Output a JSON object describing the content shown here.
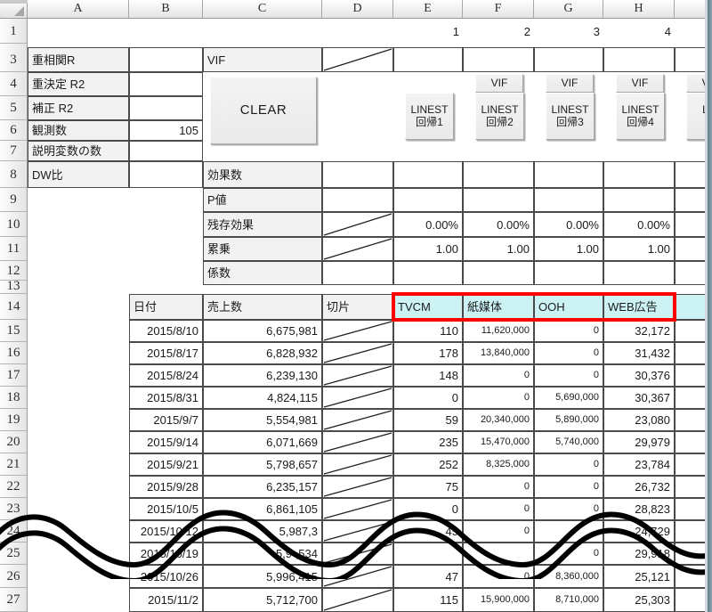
{
  "app": {
    "name": "spreadsheet",
    "kind": "excel-worksheet"
  },
  "grid": {
    "column_letters": [
      "A",
      "B",
      "C",
      "D",
      "E",
      "F",
      "G",
      "H"
    ],
    "row_numbers": [
      "1",
      "3",
      "4",
      "5",
      "6",
      "7",
      "8",
      "9",
      "10",
      "11",
      "12",
      "13",
      "14",
      "15",
      "16",
      "17",
      "18",
      "19",
      "20",
      "21",
      "22",
      "23",
      "24",
      "25",
      "26",
      "27"
    ]
  },
  "model_panel": {
    "labels": {
      "multiple_r": "重相関R",
      "r_square": "重決定 R2",
      "adj_r_square": "補正 R2",
      "observations": "観測数",
      "num_predictors": "説明変数の数",
      "dw_ratio": "DW比"
    },
    "values": {
      "multiple_r": "",
      "r_square": "",
      "adj_r_square": "",
      "observations": "105",
      "num_predictors": "",
      "dw_ratio": ""
    }
  },
  "stats_panel": {
    "row_labels": {
      "vif": "VIF",
      "effect_count": "効果数",
      "p_value": "P値",
      "carryover": "残存効果",
      "power": "累乗",
      "coefficient": "係数"
    },
    "series_index": [
      "1",
      "2",
      "3",
      "4"
    ],
    "carryover_values": [
      "0.00%",
      "0.00%",
      "0.00%",
      "0.00%"
    ],
    "power_values": [
      "1.00",
      "1.00",
      "1.00",
      "1.00"
    ],
    "effect_count_values": [
      "",
      "",
      "",
      ""
    ],
    "p_values": [
      "",
      "",
      "",
      ""
    ],
    "coefficient_values": [
      "",
      "",
      "",
      ""
    ],
    "vif_values": [
      "",
      "",
      "",
      ""
    ]
  },
  "buttons": {
    "clear": "CLEAR",
    "vif": "VIF",
    "linest": [
      {
        "line1": "LINEST",
        "line2": "回帰1"
      },
      {
        "line1": "LINEST",
        "line2": "回帰2"
      },
      {
        "line1": "LINEST",
        "line2": "回帰3"
      },
      {
        "line1": "LINEST",
        "line2": "回帰4"
      },
      {
        "line1": "LIN",
        "line2": "回"
      }
    ]
  },
  "data_table": {
    "headers": [
      "日付",
      "売上数",
      "切片",
      "TVCM",
      "紙媒体",
      "OOH",
      "WEB広告",
      ""
    ],
    "highlight_color": "#ff0000",
    "header_fill": "#ccf2f4",
    "rows": [
      {
        "row": "15",
        "date": "2015/8/10",
        "sales": "6,675,981",
        "intercept": "",
        "tvcm": "110",
        "paper": "11,620,000",
        "ooh": "0",
        "web": "32,172"
      },
      {
        "row": "16",
        "date": "2015/8/17",
        "sales": "6,828,932",
        "intercept": "",
        "tvcm": "178",
        "paper": "13,840,000",
        "ooh": "0",
        "web": "31,432"
      },
      {
        "row": "17",
        "date": "2015/8/24",
        "sales": "6,239,130",
        "intercept": "",
        "tvcm": "148",
        "paper": "0",
        "ooh": "0",
        "web": "30,376"
      },
      {
        "row": "18",
        "date": "2015/8/31",
        "sales": "4,824,115",
        "intercept": "",
        "tvcm": "0",
        "paper": "0",
        "ooh": "5,690,000",
        "web": "30,367"
      },
      {
        "row": "19",
        "date": "2015/9/7",
        "sales": "5,554,981",
        "intercept": "",
        "tvcm": "59",
        "paper": "20,340,000",
        "ooh": "5,890,000",
        "web": "23,080"
      },
      {
        "row": "20",
        "date": "2015/9/14",
        "sales": "6,071,669",
        "intercept": "",
        "tvcm": "235",
        "paper": "15,470,000",
        "ooh": "5,740,000",
        "web": "29,979"
      },
      {
        "row": "21",
        "date": "2015/9/21",
        "sales": "5,798,657",
        "intercept": "",
        "tvcm": "252",
        "paper": "8,325,000",
        "ooh": "0",
        "web": "23,784"
      },
      {
        "row": "22",
        "date": "2015/9/28",
        "sales": "6,235,157",
        "intercept": "",
        "tvcm": "75",
        "paper": "0",
        "ooh": "0",
        "web": "26,732"
      },
      {
        "row": "23",
        "date": "2015/10/5",
        "sales": "6,861,105",
        "intercept": "",
        "tvcm": "0",
        "paper": "0",
        "ooh": "0",
        "web": "28,823"
      },
      {
        "row": "24",
        "date": "2015/10/12",
        "sales": "5,987,3",
        "intercept": "",
        "tvcm": "45",
        "paper": "0",
        "ooh": "",
        "web": "24,729"
      },
      {
        "row": "25",
        "date": "2015/10/19",
        "sales": "5,9  ,534",
        "intercept": "",
        "tvcm": "",
        "paper": "",
        "ooh": "0",
        "web": "29,918"
      },
      {
        "row": "26",
        "date": "2015/10/26",
        "sales": "5,996,415",
        "intercept": "",
        "tvcm": "47",
        "paper": "0",
        "ooh": "8,360,000",
        "web": "25,121"
      },
      {
        "row": "27",
        "date": "2015/11/2",
        "sales": "5,712,700",
        "intercept": "",
        "tvcm": "115",
        "paper": "15,900,000",
        "ooh": "8,710,000",
        "web": "25,303"
      }
    ]
  }
}
